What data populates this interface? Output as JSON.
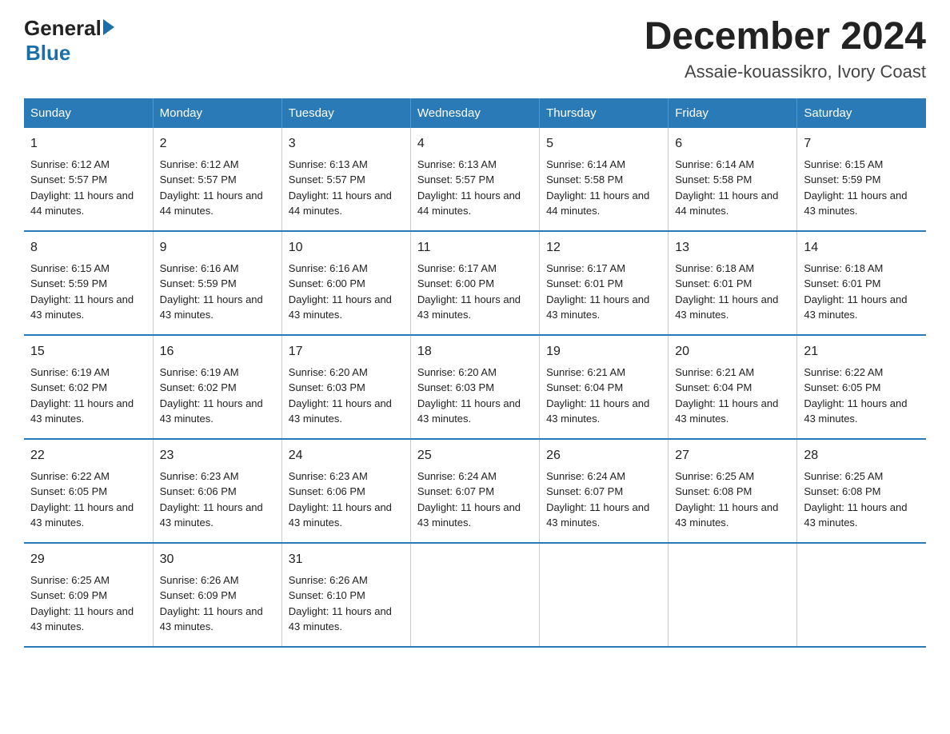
{
  "logo": {
    "general": "General",
    "arrow_char": "▶",
    "blue": "Blue"
  },
  "title": "December 2024",
  "subtitle": "Assaie-kouassikro, Ivory Coast",
  "weekdays": [
    "Sunday",
    "Monday",
    "Tuesday",
    "Wednesday",
    "Thursday",
    "Friday",
    "Saturday"
  ],
  "weeks": [
    [
      {
        "day": "1",
        "sunrise": "6:12 AM",
        "sunset": "5:57 PM",
        "daylight": "11 hours and 44 minutes."
      },
      {
        "day": "2",
        "sunrise": "6:12 AM",
        "sunset": "5:57 PM",
        "daylight": "11 hours and 44 minutes."
      },
      {
        "day": "3",
        "sunrise": "6:13 AM",
        "sunset": "5:57 PM",
        "daylight": "11 hours and 44 minutes."
      },
      {
        "day": "4",
        "sunrise": "6:13 AM",
        "sunset": "5:57 PM",
        "daylight": "11 hours and 44 minutes."
      },
      {
        "day": "5",
        "sunrise": "6:14 AM",
        "sunset": "5:58 PM",
        "daylight": "11 hours and 44 minutes."
      },
      {
        "day": "6",
        "sunrise": "6:14 AM",
        "sunset": "5:58 PM",
        "daylight": "11 hours and 44 minutes."
      },
      {
        "day": "7",
        "sunrise": "6:15 AM",
        "sunset": "5:59 PM",
        "daylight": "11 hours and 43 minutes."
      }
    ],
    [
      {
        "day": "8",
        "sunrise": "6:15 AM",
        "sunset": "5:59 PM",
        "daylight": "11 hours and 43 minutes."
      },
      {
        "day": "9",
        "sunrise": "6:16 AM",
        "sunset": "5:59 PM",
        "daylight": "11 hours and 43 minutes."
      },
      {
        "day": "10",
        "sunrise": "6:16 AM",
        "sunset": "6:00 PM",
        "daylight": "11 hours and 43 minutes."
      },
      {
        "day": "11",
        "sunrise": "6:17 AM",
        "sunset": "6:00 PM",
        "daylight": "11 hours and 43 minutes."
      },
      {
        "day": "12",
        "sunrise": "6:17 AM",
        "sunset": "6:01 PM",
        "daylight": "11 hours and 43 minutes."
      },
      {
        "day": "13",
        "sunrise": "6:18 AM",
        "sunset": "6:01 PM",
        "daylight": "11 hours and 43 minutes."
      },
      {
        "day": "14",
        "sunrise": "6:18 AM",
        "sunset": "6:01 PM",
        "daylight": "11 hours and 43 minutes."
      }
    ],
    [
      {
        "day": "15",
        "sunrise": "6:19 AM",
        "sunset": "6:02 PM",
        "daylight": "11 hours and 43 minutes."
      },
      {
        "day": "16",
        "sunrise": "6:19 AM",
        "sunset": "6:02 PM",
        "daylight": "11 hours and 43 minutes."
      },
      {
        "day": "17",
        "sunrise": "6:20 AM",
        "sunset": "6:03 PM",
        "daylight": "11 hours and 43 minutes."
      },
      {
        "day": "18",
        "sunrise": "6:20 AM",
        "sunset": "6:03 PM",
        "daylight": "11 hours and 43 minutes."
      },
      {
        "day": "19",
        "sunrise": "6:21 AM",
        "sunset": "6:04 PM",
        "daylight": "11 hours and 43 minutes."
      },
      {
        "day": "20",
        "sunrise": "6:21 AM",
        "sunset": "6:04 PM",
        "daylight": "11 hours and 43 minutes."
      },
      {
        "day": "21",
        "sunrise": "6:22 AM",
        "sunset": "6:05 PM",
        "daylight": "11 hours and 43 minutes."
      }
    ],
    [
      {
        "day": "22",
        "sunrise": "6:22 AM",
        "sunset": "6:05 PM",
        "daylight": "11 hours and 43 minutes."
      },
      {
        "day": "23",
        "sunrise": "6:23 AM",
        "sunset": "6:06 PM",
        "daylight": "11 hours and 43 minutes."
      },
      {
        "day": "24",
        "sunrise": "6:23 AM",
        "sunset": "6:06 PM",
        "daylight": "11 hours and 43 minutes."
      },
      {
        "day": "25",
        "sunrise": "6:24 AM",
        "sunset": "6:07 PM",
        "daylight": "11 hours and 43 minutes."
      },
      {
        "day": "26",
        "sunrise": "6:24 AM",
        "sunset": "6:07 PM",
        "daylight": "11 hours and 43 minutes."
      },
      {
        "day": "27",
        "sunrise": "6:25 AM",
        "sunset": "6:08 PM",
        "daylight": "11 hours and 43 minutes."
      },
      {
        "day": "28",
        "sunrise": "6:25 AM",
        "sunset": "6:08 PM",
        "daylight": "11 hours and 43 minutes."
      }
    ],
    [
      {
        "day": "29",
        "sunrise": "6:25 AM",
        "sunset": "6:09 PM",
        "daylight": "11 hours and 43 minutes."
      },
      {
        "day": "30",
        "sunrise": "6:26 AM",
        "sunset": "6:09 PM",
        "daylight": "11 hours and 43 minutes."
      },
      {
        "day": "31",
        "sunrise": "6:26 AM",
        "sunset": "6:10 PM",
        "daylight": "11 hours and 43 minutes."
      },
      {
        "day": "",
        "sunrise": "",
        "sunset": "",
        "daylight": ""
      },
      {
        "day": "",
        "sunrise": "",
        "sunset": "",
        "daylight": ""
      },
      {
        "day": "",
        "sunrise": "",
        "sunset": "",
        "daylight": ""
      },
      {
        "day": "",
        "sunrise": "",
        "sunset": "",
        "daylight": ""
      }
    ]
  ]
}
